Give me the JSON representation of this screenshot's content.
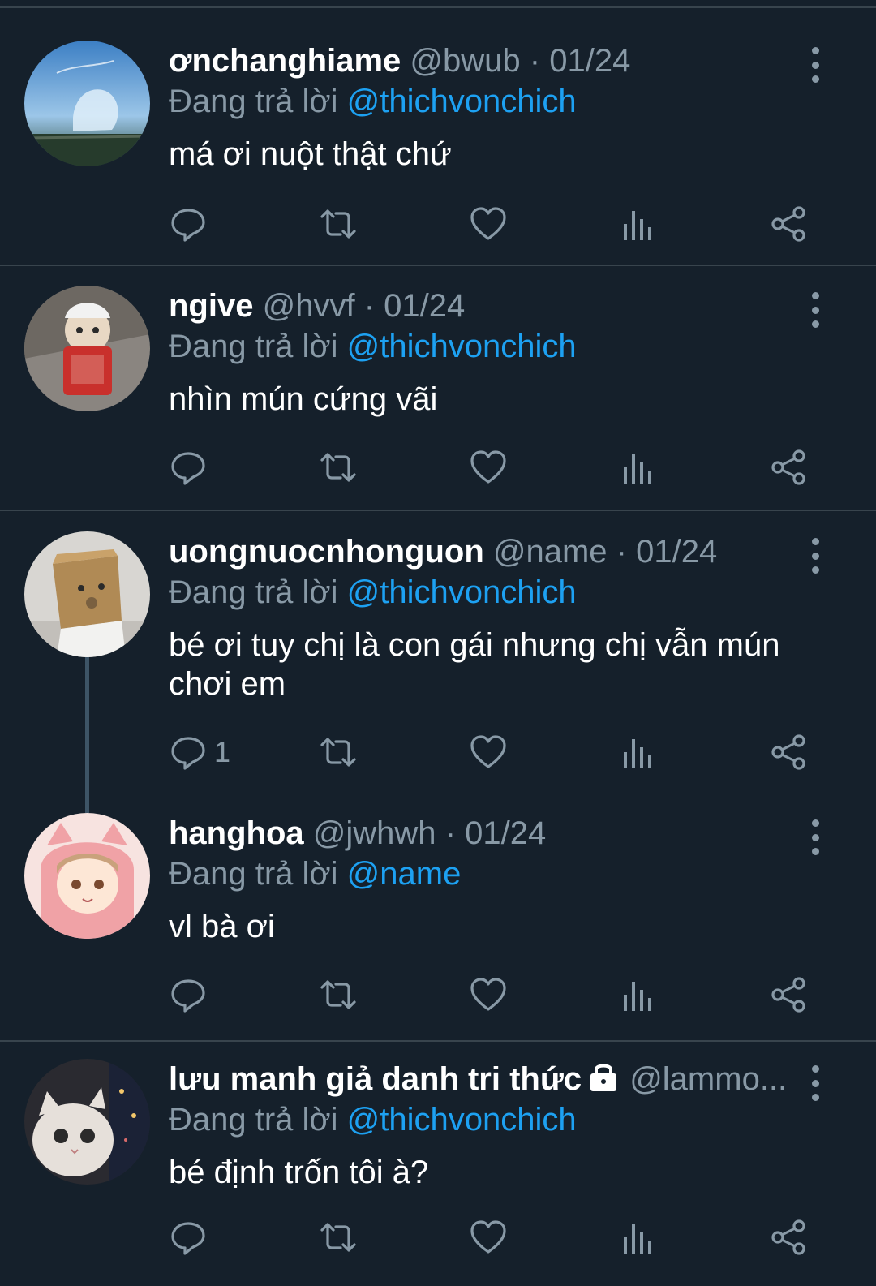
{
  "tweets": [
    {
      "name": "ơnchanghiame",
      "handle": "@bwub",
      "separator": "·",
      "date": "01/24",
      "reply_prefix": "Đang trả lời",
      "reply_to": "@thichvonchich",
      "text": "má ơi nuột thật chứ",
      "reply_count": ""
    },
    {
      "name": "ngive",
      "handle": "@hvvf",
      "separator": "·",
      "date": "01/24",
      "reply_prefix": "Đang trả lời",
      "reply_to": "@thichvonchich",
      "text": "nhìn mún cứng vãi",
      "reply_count": ""
    },
    {
      "name": "uongnuocnhonguon",
      "handle": "@name",
      "separator": "·",
      "date": "01/24",
      "reply_prefix": "Đang trả lời",
      "reply_to": "@thichvonchich",
      "text": "bé ơi tuy chị là con gái nhưng chị vẫn mún chơi em",
      "reply_count": "1"
    },
    {
      "name": "hanghoa",
      "handle": "@jwhwh",
      "separator": "·",
      "date": "01/24",
      "reply_prefix": "Đang trả lời",
      "reply_to": "@name",
      "text": "vl bà ơi",
      "reply_count": ""
    },
    {
      "name": "lưu manh giả danh tri thức",
      "handle": "@lammo...",
      "separator": "",
      "date": "",
      "reply_prefix": "Đang trả lời",
      "reply_to": "@thichvonchich",
      "text": "bé định trốn tôi à?",
      "reply_count": ""
    }
  ],
  "icons": {
    "reply": "reply-icon",
    "retweet": "retweet-icon",
    "like": "heart-icon",
    "analytics": "analytics-icon",
    "share": "share-icon",
    "more": "more-vertical-icon",
    "locked": "lock-icon"
  },
  "colors": {
    "background": "#15202b",
    "divider": "#38444d",
    "text_primary": "#ffffff",
    "text_secondary": "#8899a6",
    "mention": "#1da1f2"
  }
}
